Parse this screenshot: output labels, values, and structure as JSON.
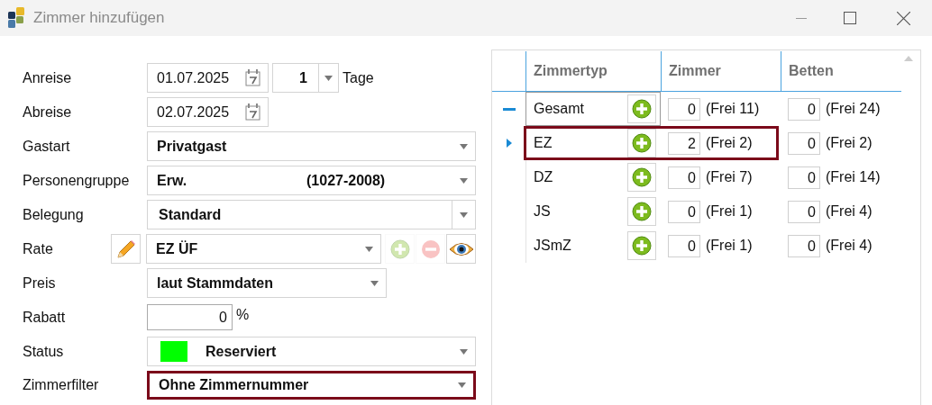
{
  "window": {
    "title": "Zimmer hinzufügen"
  },
  "fields": [
    {
      "kind": "date",
      "label": "Anreise",
      "value": "01.07.2025",
      "highlighted": false,
      "days": {
        "value": "1",
        "unit": "Tage"
      }
    },
    {
      "kind": "date",
      "label": "Abreise",
      "value": "02.07.2025",
      "highlighted": false
    },
    {
      "kind": "select",
      "label": "Gastart",
      "value": "Privatgast",
      "highlighted": false
    },
    {
      "kind": "select",
      "label": "Personengruppe",
      "value": "Erw.",
      "extra": "(1027-2008)",
      "highlighted": false
    },
    {
      "kind": "combo",
      "label": "Belegung",
      "value": "Standard",
      "highlighted": false
    },
    {
      "kind": "rate",
      "label": "Rate",
      "value": "EZ ÜF",
      "highlighted": false,
      "add_disabled": true,
      "remove_disabled": true
    },
    {
      "kind": "short",
      "label": "Preis",
      "value": "laut Stammdaten",
      "highlighted": false
    },
    {
      "kind": "number",
      "label": "Rabatt",
      "value": "0",
      "unit": "%",
      "highlighted": false
    },
    {
      "kind": "status",
      "label": "Status",
      "value": "Reserviert",
      "color": "#00ff00",
      "highlighted": false
    },
    {
      "kind": "select",
      "label": "Zimmerfilter",
      "value": "Ohne Zimmernummer",
      "highlighted": true
    }
  ],
  "grid": {
    "columns": [
      "Zimmertyp",
      "Zimmer",
      "Betten"
    ],
    "total": {
      "type": "Gesamt",
      "expanded": true,
      "rooms": "0",
      "rooms_free": "(Frei 11)",
      "beds": "0",
      "beds_free": "(Frei 24)"
    },
    "rows": [
      {
        "type": "EZ",
        "selected": true,
        "highlighted": true,
        "rooms": "2",
        "rooms_free": "(Frei 2)",
        "beds": "0",
        "beds_free": "(Frei 2)"
      },
      {
        "type": "DZ",
        "selected": false,
        "highlighted": false,
        "rooms": "0",
        "rooms_free": "(Frei 7)",
        "beds": "0",
        "beds_free": "(Frei 14)"
      },
      {
        "type": "JS",
        "selected": false,
        "highlighted": false,
        "rooms": "0",
        "rooms_free": "(Frei 1)",
        "beds": "0",
        "beds_free": "(Frei 4)"
      },
      {
        "type": "JSmZ",
        "selected": false,
        "highlighted": false,
        "rooms": "0",
        "rooms_free": "(Frei 1)",
        "beds": "0",
        "beds_free": "(Frei 4)"
      }
    ]
  }
}
